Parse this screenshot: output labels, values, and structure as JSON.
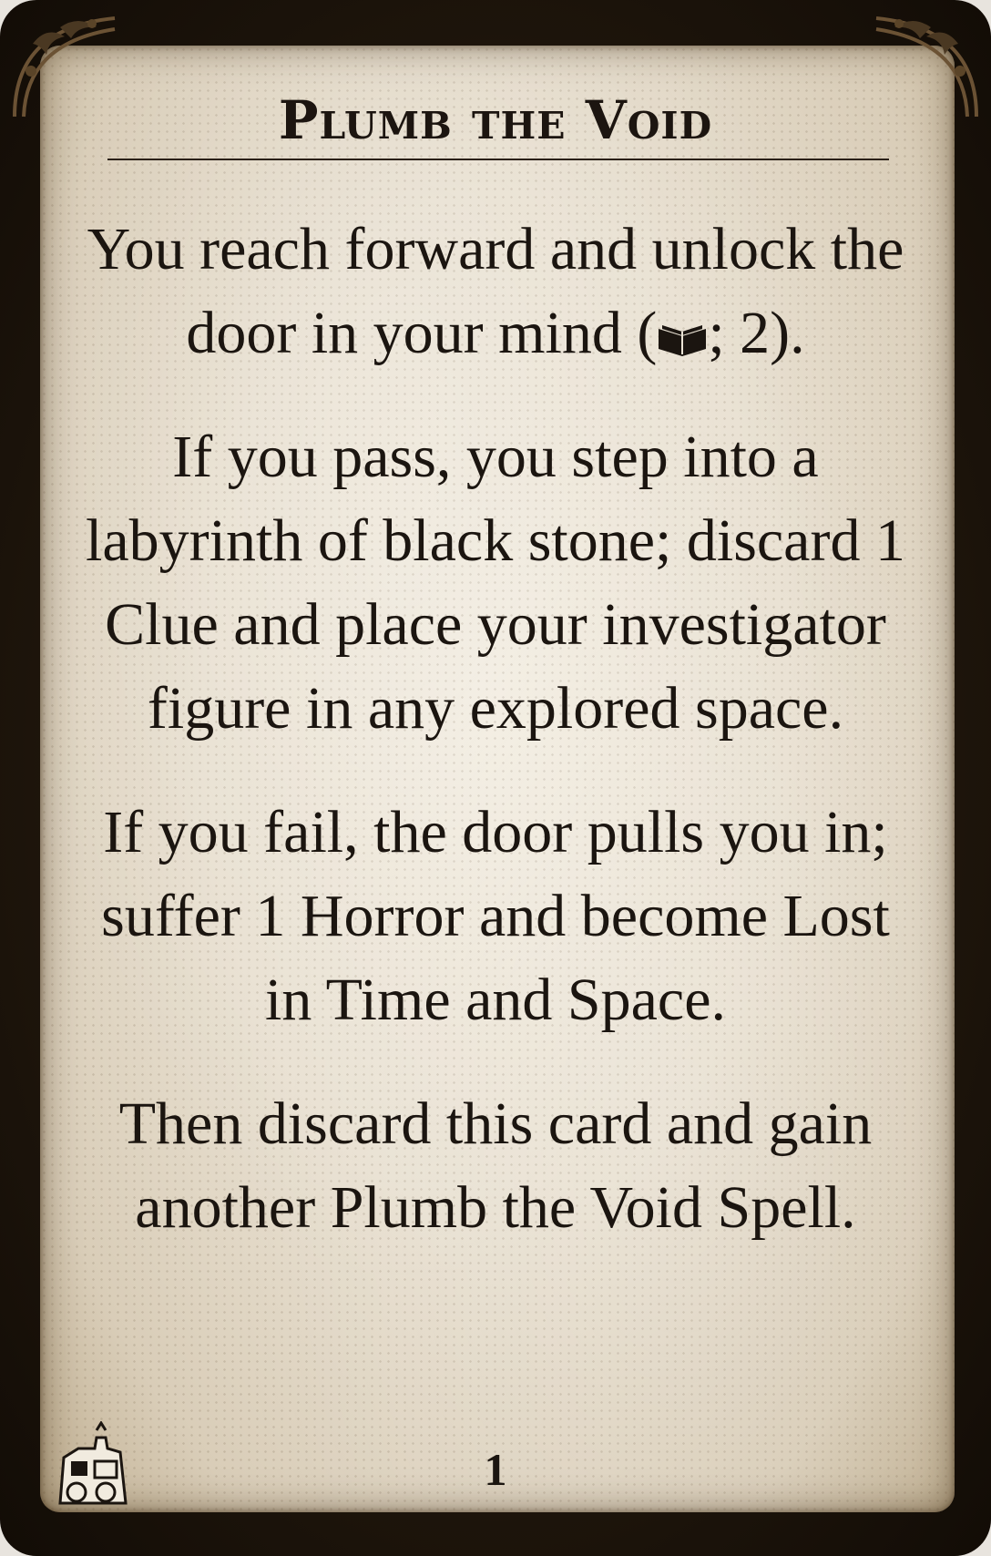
{
  "card": {
    "title": "Plumb the Void",
    "paragraphs": {
      "p1_before_icon": "You reach forward and unlock the door in your mind (",
      "p1_after_icon": "; 2).",
      "p2": "If you pass, you step into a labyrinth of black stone; discard 1 Clue and place your investigator figure in any explored space.",
      "p3": "If you fail, the door pulls you in; suffer 1 Horror and become Lost in Time and Space.",
      "p4": "Then discard this card and gain another Plumb the Void Spell."
    },
    "skill_icon": "lore-book-icon",
    "number": "1",
    "expansion_icon": "train-set-icon"
  },
  "colors": {
    "frame": "#1f160c",
    "parchment": "#ece4d6",
    "ink": "#1b1510"
  }
}
